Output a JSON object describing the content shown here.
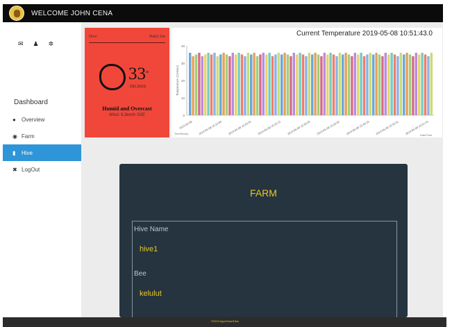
{
  "header": {
    "welcome": "WELCOME JOHN CENA"
  },
  "sidebar": {
    "icons": [
      "envelope-icon",
      "user-icon",
      "gear-icon"
    ],
    "section_title": "Dashboard",
    "items": [
      {
        "label": "Overview",
        "icon": "globe-icon"
      },
      {
        "label": "Farm",
        "icon": "farm-icon"
      },
      {
        "label": "Hive",
        "icon": "hive-icon",
        "active": true
      },
      {
        "label": "LogOut",
        "icon": "logout-icon"
      }
    ]
  },
  "weather": {
    "location_left": "Hive",
    "location_right": "Bukit Sin",
    "temperature": "33",
    "degree": "°",
    "unit_label": "CELSIUS",
    "condition": "Humid and Overcast",
    "wind": "Wind: 9.3km/h SSE",
    "bg_color": "#f0473a"
  },
  "chart_data": {
    "type": "bar",
    "title": "Current Temperature 2019-05-08 10:51:43.0",
    "ylabel": "Temperature (Celsius)",
    "xlabel_left": "TimeStamp",
    "xlabel_right": "DateTime",
    "ylim": [
      0,
      40
    ],
    "yticks": [
      "0",
      "10",
      "20",
      "30",
      "40"
    ],
    "xtick_labels": [
      "2019-05-08",
      "2019-05-08 10:15:09",
      "2019-05-08 10:20:45",
      "2019-05-08 10:25:13",
      "2019-05-08 10:30:20",
      "2019-05-08 10:35:02",
      "2019-05-08 10:40:18",
      "2019-05-08 10:45:31",
      "2019-05-08 10:51:43"
    ],
    "values": [
      36,
      34,
      35,
      36,
      34,
      35,
      36,
      35,
      36,
      34,
      35,
      36,
      35,
      34,
      36,
      35,
      36,
      35,
      34,
      36,
      35,
      36,
      34,
      35,
      36,
      35,
      36,
      34,
      35,
      36,
      35,
      36,
      35,
      34,
      36,
      35,
      36,
      35,
      34,
      36,
      35,
      36,
      35,
      34,
      36,
      35,
      36,
      35,
      34,
      36,
      35,
      36,
      35,
      34,
      36,
      35,
      36,
      34,
      35,
      36,
      35,
      36,
      35,
      34,
      36,
      35,
      36,
      35,
      34,
      36,
      35,
      36,
      35,
      34,
      36,
      35,
      36,
      35,
      34,
      36
    ],
    "colors": [
      "#6aa7d8",
      "#e8a05a",
      "#9bd07a",
      "#d96a8a",
      "#b58de0",
      "#e9d36a",
      "#6fcfc6",
      "#ef7c6b",
      "#8bb2e8",
      "#c7dd73"
    ]
  },
  "farm": {
    "title": "FARM",
    "fields": [
      {
        "label": "Hive Name",
        "value": "hive1"
      },
      {
        "label": "Bee",
        "value": "kelulut"
      }
    ]
  },
  "footer": {
    "text": "©2019 AgroSmartHive"
  }
}
